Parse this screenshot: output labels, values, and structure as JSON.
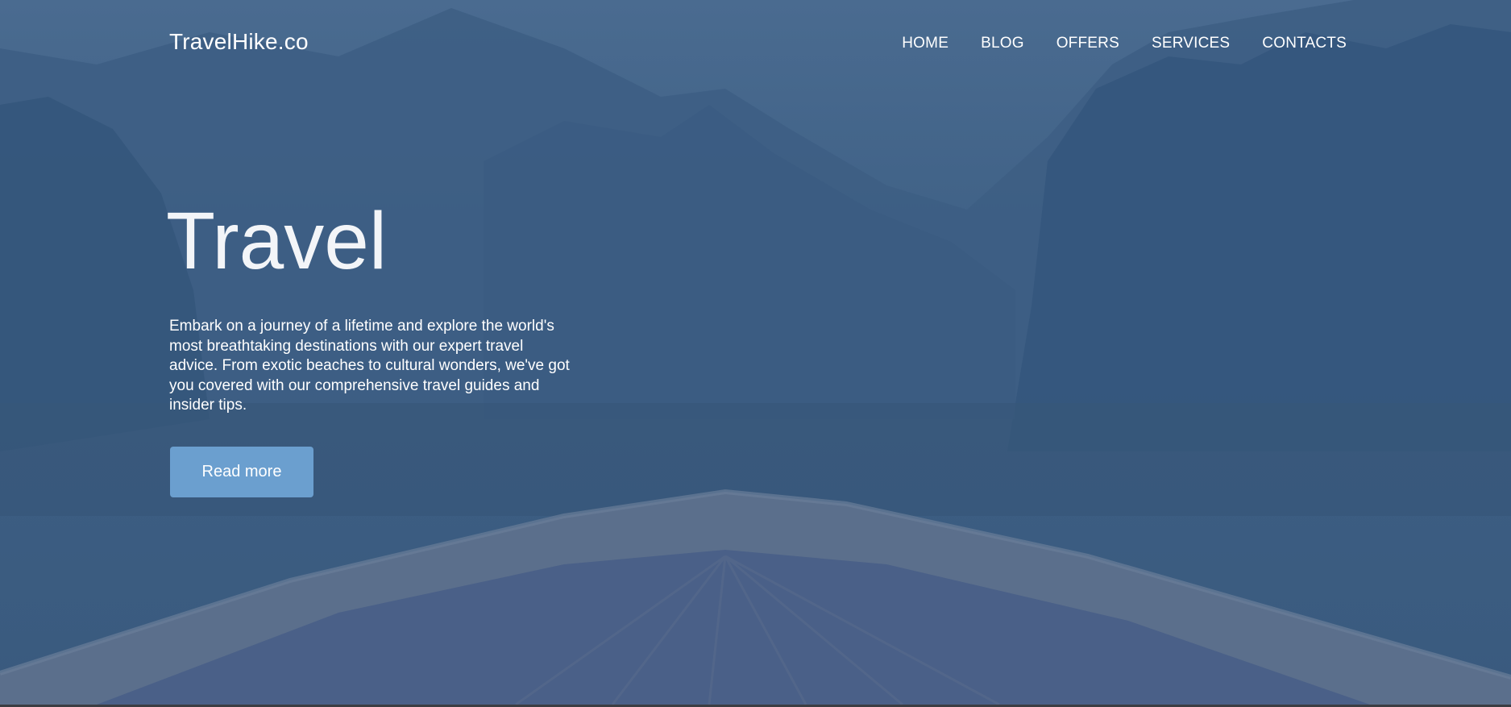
{
  "header": {
    "logo": "TravelHike.co",
    "nav": [
      "HOME",
      "BLOG",
      "OFFERS",
      "SERVICES",
      "CONTACTS"
    ]
  },
  "hero": {
    "title": "Travel",
    "description": "Embark on a journey of a lifetime and explore the world's most breathtaking destinations with our expert travel advice. From exotic beaches to cultural wonders, we've got you covered with our comprehensive travel guides and insider tips.",
    "cta_label": "Read more"
  },
  "colors": {
    "overlay": "#3f6186",
    "button": "#6b9fcf",
    "text": "#ffffff"
  }
}
